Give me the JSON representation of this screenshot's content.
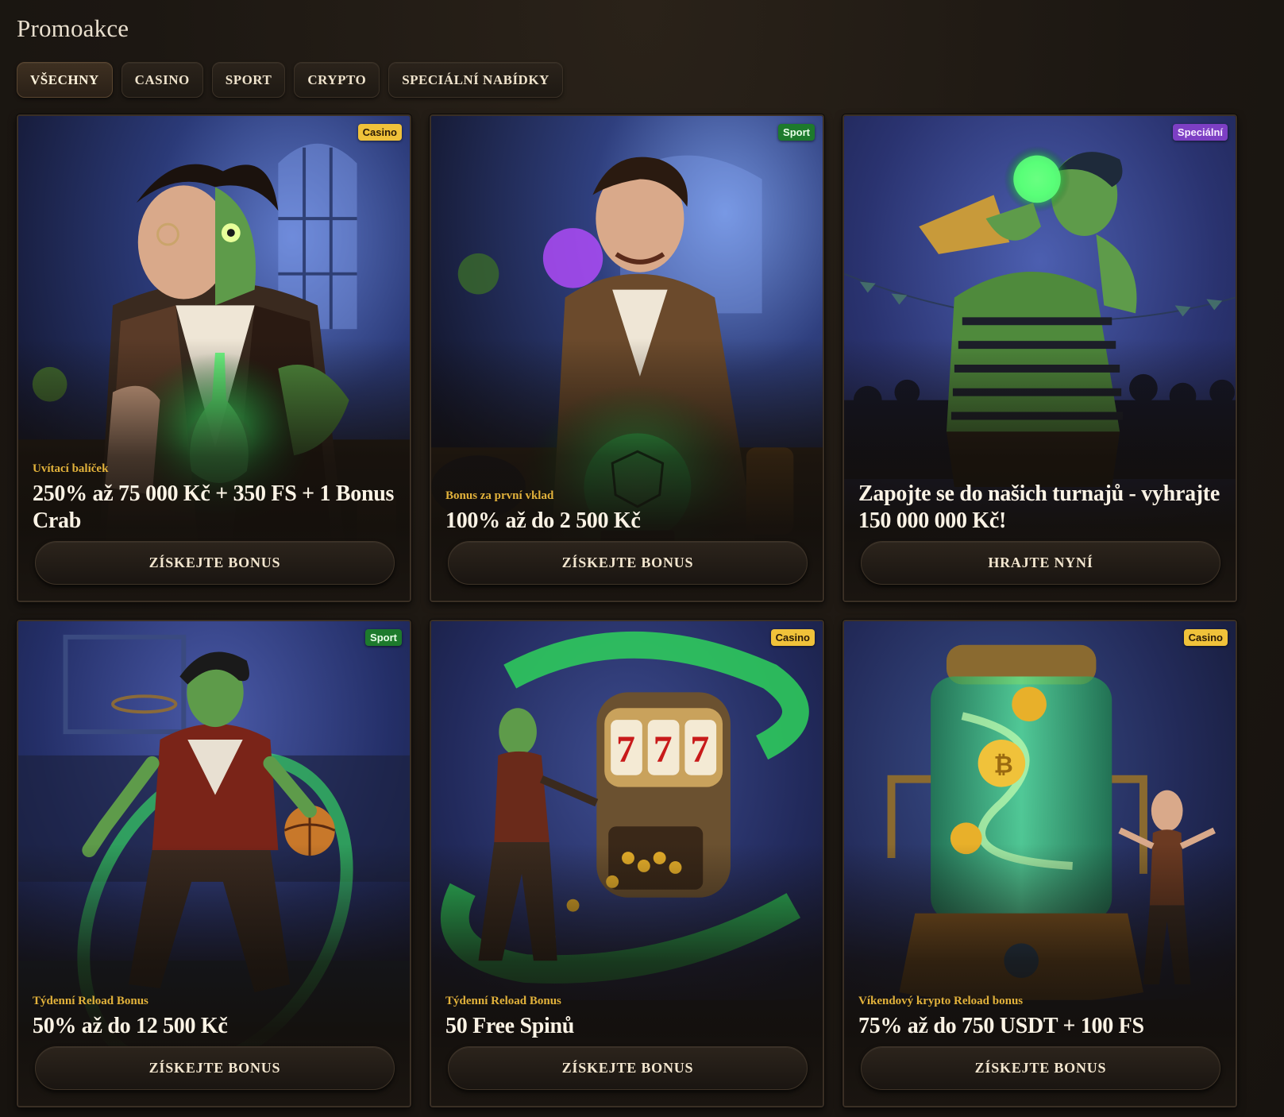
{
  "page": {
    "title": "Promoakce"
  },
  "tabs": [
    {
      "label": "VŠECHNY",
      "active": true
    },
    {
      "label": "CASINO",
      "active": false
    },
    {
      "label": "SPORT",
      "active": false
    },
    {
      "label": "CRYPTO",
      "active": false
    },
    {
      "label": "SPECIÁLNÍ NABÍDKY",
      "active": false
    }
  ],
  "cards": [
    {
      "badge": "Casino",
      "badge_type": "casino",
      "subtitle": "Uvítací balíček",
      "headline": "250% až 75 000 Kč + 350 FS + 1 Bonus Crab",
      "cta": "ZÍSKEJTE BONUS"
    },
    {
      "badge": "Sport",
      "badge_type": "sport",
      "subtitle": "Bonus za první vklad",
      "headline": "100% až do 2 500 Kč",
      "cta": "ZÍSKEJTE BONUS"
    },
    {
      "badge": "Speciální",
      "badge_type": "special",
      "subtitle": "",
      "headline": "Zapojte se do našich turnajů - vyhrajte 150 000 000 Kč!",
      "cta": "HRAJTE NYNÍ"
    },
    {
      "badge": "Sport",
      "badge_type": "sport",
      "subtitle": "Týdenní Reload Bonus",
      "headline": "50% až do 12 500 Kč",
      "cta": "ZÍSKEJTE BONUS"
    },
    {
      "badge": "Casino",
      "badge_type": "casino",
      "subtitle": "Týdenní Reload Bonus",
      "headline": "50 Free Spinů",
      "cta": "ZÍSKEJTE BONUS"
    },
    {
      "badge": "Casino",
      "badge_type": "casino",
      "subtitle": "Víkendový krypto Reload bonus",
      "headline": "75% až do 750 USDT + 100 FS",
      "cta": "ZÍSKEJTE BONUS"
    }
  ],
  "colors": {
    "background": "#1c1712",
    "accent_gold": "#e2b23b",
    "badge_casino": "#f0c23a",
    "badge_sport": "#1d7a2c",
    "badge_special": "#7d3fc4",
    "glow_green": "#3dff6a"
  }
}
